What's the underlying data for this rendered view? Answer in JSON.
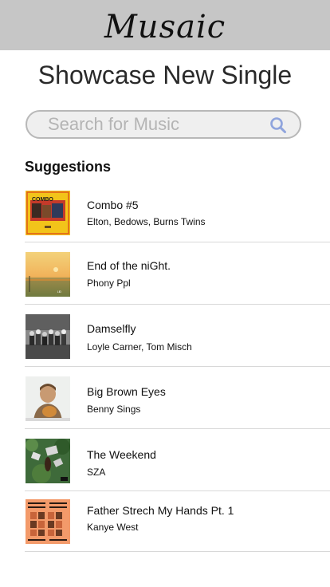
{
  "header": {
    "logo_text": "Musaic"
  },
  "page": {
    "title": "Showcase New Single"
  },
  "search": {
    "placeholder": "Search for Music",
    "value": ""
  },
  "suggestions": {
    "heading": "Suggestions",
    "items": [
      {
        "title": "Combo #5",
        "artist": "Elton, Bedows, Burns Twins",
        "art_icon": "album-art-combo"
      },
      {
        "title": "End of the niGht.",
        "artist": "Phony Ppl",
        "art_icon": "album-art-sunset"
      },
      {
        "title": "Damselfly",
        "artist": "Loyle Carner, Tom Misch",
        "art_icon": "album-art-group-photo"
      },
      {
        "title": "Big Brown Eyes",
        "artist": "Benny Sings",
        "art_icon": "album-art-portrait"
      },
      {
        "title": "The Weekend",
        "artist": "SZA",
        "art_icon": "album-art-garden"
      },
      {
        "title": "Father Strech My Hands Pt. 1",
        "artist": "Kanye West",
        "art_icon": "album-art-tlop"
      }
    ]
  },
  "colors": {
    "header_bg": "#c6c6c6",
    "search_icon": "#8fa4dd",
    "divider": "#d8d8d8"
  }
}
